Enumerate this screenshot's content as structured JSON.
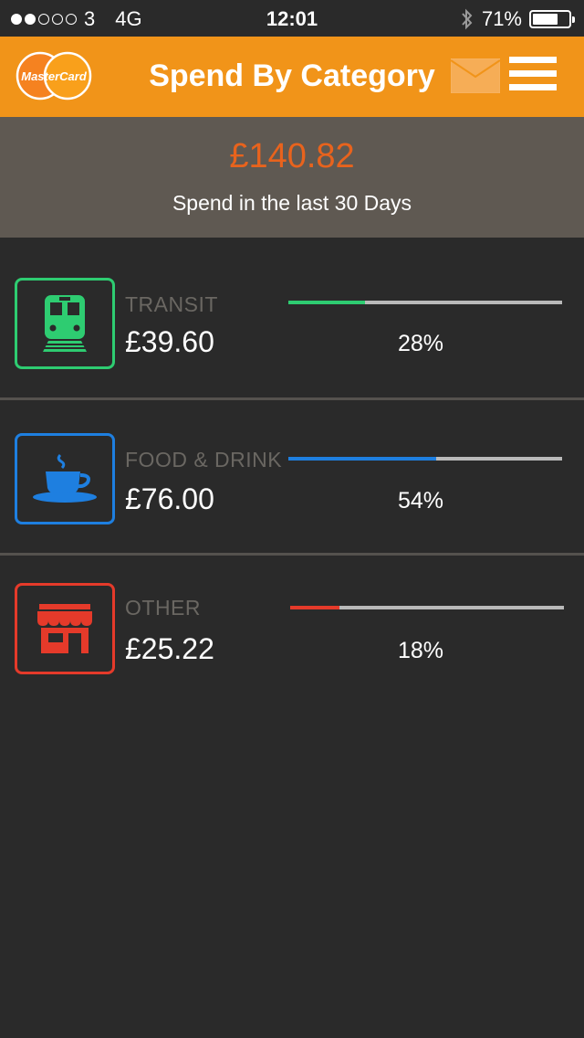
{
  "status_bar": {
    "carrier": "3",
    "network": "4G",
    "time": "12:01",
    "battery": "71%",
    "battery_level": 0.71
  },
  "header": {
    "logo_text": "MasterCard",
    "title": "Spend By Category"
  },
  "summary": {
    "amount": "£140.82",
    "label": "Spend in the last 30 Days"
  },
  "categories": [
    {
      "name": "TRANSIT",
      "amount": "£39.60",
      "percent": "28%",
      "fraction": 0.28,
      "color": "#2ecc71",
      "icon": "train-icon"
    },
    {
      "name": "FOOD & DRINK",
      "amount": "£76.00",
      "percent": "54%",
      "fraction": 0.54,
      "color": "#1e7fe0",
      "icon": "coffee-cup-icon"
    },
    {
      "name": "OTHER",
      "amount": "£25.22",
      "percent": "18%",
      "fraction": 0.18,
      "color": "#e53a2a",
      "icon": "store-icon"
    }
  ],
  "colors": {
    "header": "#f19419",
    "summary_amount": "#e8631d",
    "summary_bg": "#5f5952",
    "background": "#2a2a2a"
  }
}
